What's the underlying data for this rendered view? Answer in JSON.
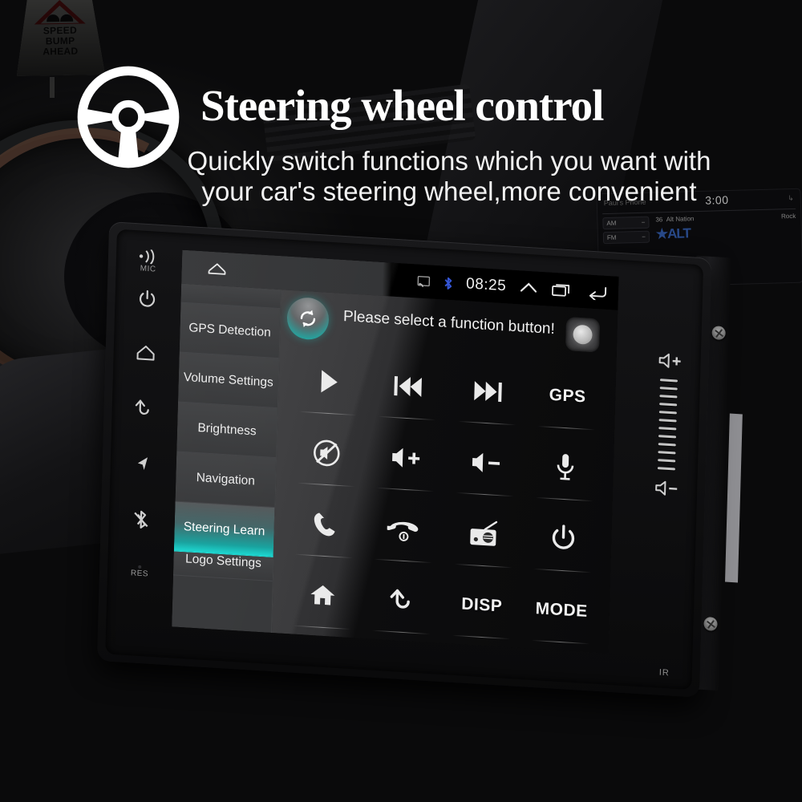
{
  "header": {
    "title": "Steering wheel control",
    "subtitle": "Quickly switch functions which you want with your car's steering wheel,more convenient",
    "icon": "steering-wheel-icon"
  },
  "road_sign": {
    "line1": "SPEED",
    "line2": "BUMP",
    "line3": "AHEAD",
    "icon": "speed-bump-warning-icon"
  },
  "background_radio": {
    "device_name": "Paul's Phone",
    "clock": "3:00",
    "band_am": "AM",
    "band_fm": "FM",
    "channel_number": "36",
    "channel_name": "Alt Nation",
    "genre": "Rock",
    "station_logo": "ALT"
  },
  "head_unit": {
    "left_bezel": [
      {
        "name": "mic-indicator",
        "label": "MIC",
        "icon": "mic-waves-icon"
      },
      {
        "name": "power-button",
        "label": "",
        "icon": "power-icon"
      },
      {
        "name": "home-button",
        "label": "",
        "icon": "home-outline-icon"
      },
      {
        "name": "back-button",
        "label": "",
        "icon": "back-arrow-icon"
      },
      {
        "name": "navigation-button",
        "label": "",
        "icon": "navigation-arrow-icon"
      },
      {
        "name": "bluetooth-button",
        "label": "",
        "icon": "bluetooth-icon"
      },
      {
        "name": "reset-pinhole",
        "label": "RES",
        "icon": "reset-pinhole-icon"
      }
    ],
    "right_bezel": {
      "volume_up": "volume-up-icon",
      "volume_down": "volume-down-icon",
      "tick_count": 12,
      "ir_label": "IR"
    }
  },
  "screen": {
    "status_bar": {
      "home_icon": "home-outline-icon",
      "cast_icon": "screen-cast-icon",
      "bluetooth_icon": "bluetooth-icon",
      "bluetooth_color": "#3556d6",
      "clock": "08:25",
      "expand_icon": "chevron-up-icon",
      "recents_icon": "recent-apps-icon",
      "back_icon": "back-arrow-icon"
    },
    "sidebar": {
      "partial_top_label": "",
      "items": [
        {
          "label": "GPS Detection",
          "active": false
        },
        {
          "label": "Volume Settings",
          "active": false
        },
        {
          "label": "Brightness",
          "active": false
        },
        {
          "label": "Navigation",
          "active": false
        },
        {
          "label": "Steering Learn",
          "active": true
        },
        {
          "label": "Logo Settings",
          "active": false
        }
      ],
      "active_color": "#12d6cf"
    },
    "function_panel": {
      "title": "Please select a function button!",
      "reset_icon": "refresh-circle-icon",
      "record_indicator": "learn-indicator-button",
      "buttons": [
        {
          "name": "play-button",
          "icon": "play-icon",
          "label": ""
        },
        {
          "name": "previous-button",
          "icon": "previous-track-icon",
          "label": ""
        },
        {
          "name": "next-button",
          "icon": "next-track-icon",
          "label": ""
        },
        {
          "name": "gps-button",
          "icon": "text-label",
          "label": "GPS"
        },
        {
          "name": "mute-button",
          "icon": "mute-icon",
          "label": ""
        },
        {
          "name": "volume-up-button",
          "icon": "volume-up-icon",
          "label": ""
        },
        {
          "name": "volume-down-button",
          "icon": "volume-down-icon",
          "label": ""
        },
        {
          "name": "mic-button",
          "icon": "microphone-icon",
          "label": ""
        },
        {
          "name": "call-answer-button",
          "icon": "phone-icon",
          "label": ""
        },
        {
          "name": "call-hangup-button",
          "icon": "phone-hangup-icon",
          "label": ""
        },
        {
          "name": "radio-button",
          "icon": "radio-icon",
          "label": ""
        },
        {
          "name": "power-button",
          "icon": "power-icon",
          "label": ""
        },
        {
          "name": "home-button",
          "icon": "home-filled-icon",
          "label": ""
        },
        {
          "name": "back-button",
          "icon": "back-arrow-icon",
          "label": ""
        },
        {
          "name": "disp-button",
          "icon": "text-label",
          "label": "DISP"
        },
        {
          "name": "mode-button",
          "icon": "text-label",
          "label": "MODE"
        }
      ]
    }
  }
}
